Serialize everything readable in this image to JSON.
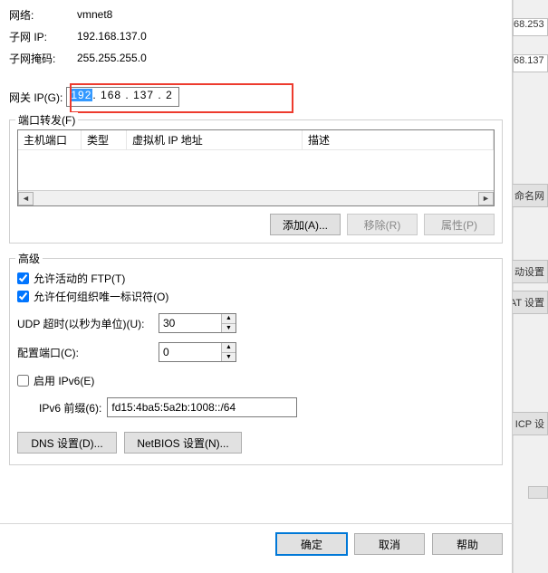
{
  "info": {
    "network_label": "网络:",
    "network_value": "vmnet8",
    "subnet_ip_label": "子网 IP:",
    "subnet_ip_value": "192.168.137.0",
    "subnet_mask_label": "子网掩码:",
    "subnet_mask_value": "255.255.255.0",
    "gateway_label": "网关 IP(G):",
    "gateway_value_sel": "192",
    "gateway_value_rest": ". 168 . 137 .   2"
  },
  "port_forwarding": {
    "legend": "端口转发(F)",
    "columns": {
      "host_port": "主机端口",
      "type": "类型",
      "vm_ip": "虚拟机 IP 地址",
      "desc": "描述"
    },
    "buttons": {
      "add": "添加(A)...",
      "remove": "移除(R)",
      "props": "属性(P)"
    },
    "scroll_left": "◄",
    "scroll_right": "►"
  },
  "advanced": {
    "legend": "高级",
    "allow_active_ftp": "允许活动的 FTP(T)",
    "allow_oui": "允许任何组织唯一标识符(O)",
    "udp_timeout_label": "UDP 超时(以秒为单位)(U):",
    "udp_timeout_value": "30",
    "config_port_label": "配置端口(C):",
    "config_port_value": "0",
    "enable_ipv6": "启用 IPv6(E)",
    "ipv6_prefix_label": "IPv6 前缀(6):",
    "ipv6_prefix_value": "fd15:4ba5:5a2b:1008::/64",
    "dns_btn": "DNS 设置(D)...",
    "netbios_btn": "NetBIOS 设置(N)..."
  },
  "footer": {
    "ok": "确定",
    "cancel": "取消",
    "help": "帮助"
  },
  "behind": {
    "ip1": "68.253",
    "ip2": "68.137",
    "rename": "命名网",
    "auto": "动设置",
    "nat": "AT 设置",
    "dhcp": "ICP 设"
  }
}
